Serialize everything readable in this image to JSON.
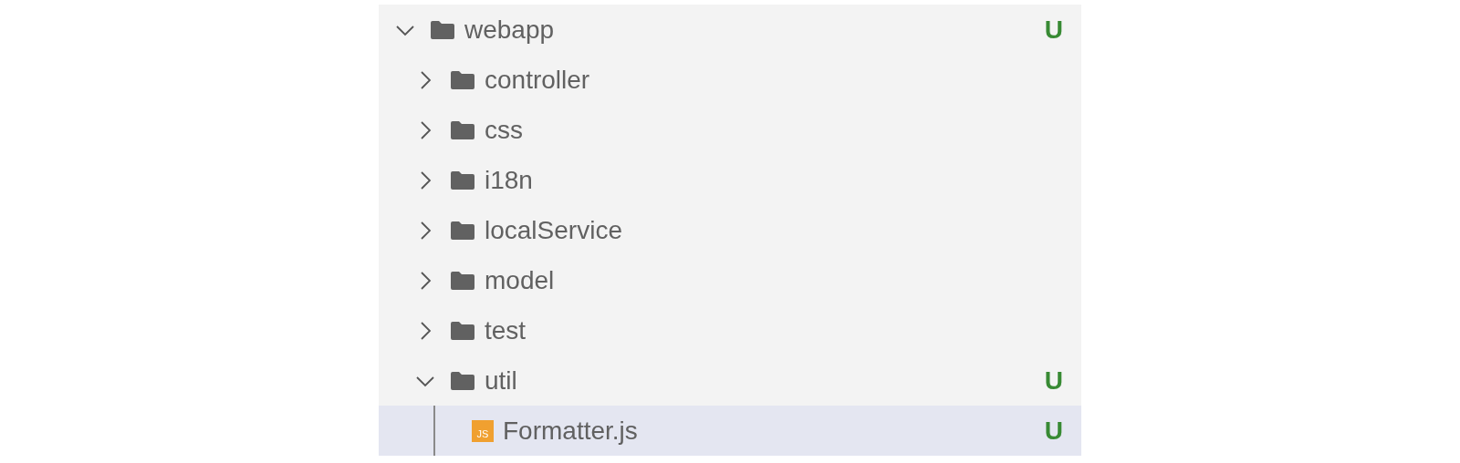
{
  "tree": [
    {
      "kind": "folder",
      "name": "webapp",
      "expanded": true,
      "selected": false,
      "badge": "U",
      "children": [
        {
          "kind": "folder",
          "name": "controller",
          "expanded": false,
          "selected": false
        },
        {
          "kind": "folder",
          "name": "css",
          "expanded": false,
          "selected": false
        },
        {
          "kind": "folder",
          "name": "i18n",
          "expanded": false,
          "selected": false
        },
        {
          "kind": "folder",
          "name": "localService",
          "expanded": false,
          "selected": false
        },
        {
          "kind": "folder",
          "name": "model",
          "expanded": false,
          "selected": false
        },
        {
          "kind": "folder",
          "name": "test",
          "expanded": false,
          "selected": false
        },
        {
          "kind": "folder",
          "name": "util",
          "expanded": true,
          "selected": false,
          "badge": "U",
          "children": [
            {
              "kind": "js-file",
              "name": "Formatter.js",
              "selected": true,
              "badge": "U",
              "icon_text": "JS"
            }
          ]
        }
      ]
    }
  ]
}
